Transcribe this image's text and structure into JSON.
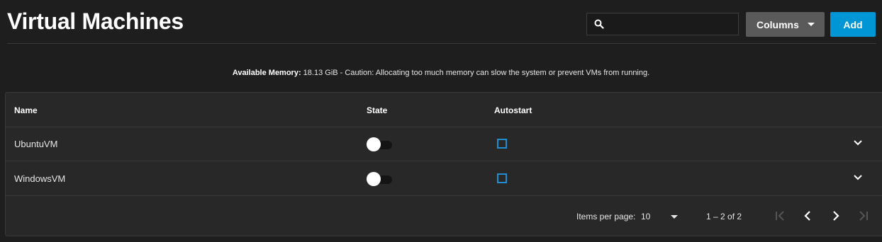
{
  "page": {
    "title": "Virtual Machines"
  },
  "toolbar": {
    "search_value": "",
    "columns_label": "Columns",
    "add_label": "Add"
  },
  "memory": {
    "label": "Available Memory:",
    "text": " 18.13 GiB - Caution: Allocating too much memory can slow the system or prevent VMs from running."
  },
  "table": {
    "headers": {
      "name": "Name",
      "state": "State",
      "autostart": "Autostart"
    },
    "rows": [
      {
        "name": "UbuntuVM",
        "state_on": false,
        "autostart": false
      },
      {
        "name": "WindowsVM",
        "state_on": false,
        "autostart": false
      }
    ]
  },
  "paginator": {
    "items_per_page_label": "Items per page:",
    "items_per_page": "10",
    "range": "1 – 2 of 2"
  },
  "colors": {
    "accent": "#0095d5",
    "background": "#1e1e1e",
    "card": "#282828"
  }
}
